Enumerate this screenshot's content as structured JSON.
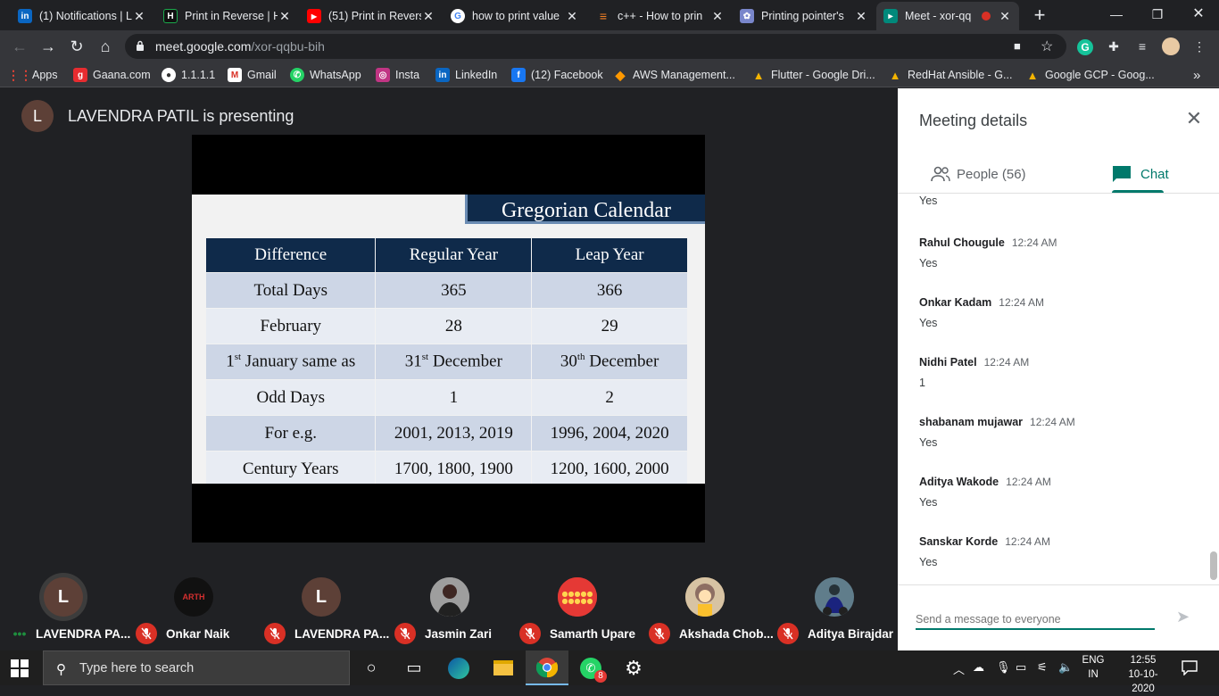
{
  "browser": {
    "tabs": [
      {
        "title": "(1) Notifications | L",
        "icon": "linkedin-icon",
        "color": "#0a66c2",
        "glyph": "in"
      },
      {
        "title": "Print in Reverse | H",
        "icon": "hackerrank-icon",
        "color": "#1ba94c",
        "glyph": "H"
      },
      {
        "title": "(51) Print in Revers",
        "icon": "youtube-icon",
        "color": "#ff0000",
        "glyph": "▶"
      },
      {
        "title": "how to print value",
        "icon": "google-icon",
        "color": "#ffffff",
        "glyph": "G"
      },
      {
        "title": "c++ - How to prin",
        "icon": "stackoverflow-icon",
        "color": "#f48024",
        "glyph": "≡"
      },
      {
        "title": "Printing pointer's",
        "icon": "site-icon",
        "color": "#7986cb",
        "glyph": "✿"
      },
      {
        "title": "Meet - xor-qq",
        "icon": "meet-icon",
        "color": "#00897b",
        "glyph": "▸"
      }
    ],
    "url_domain": "meet.google.com",
    "url_path": "/xor-qqbu-bih",
    "bookmarks": [
      {
        "label": "Apps",
        "icon": "apps-grid-icon",
        "color": "#ea4335",
        "glyph": "⋮"
      },
      {
        "label": "Gaana.com",
        "icon": "gaana-icon",
        "color": "#e72c30",
        "glyph": "g"
      },
      {
        "label": "1.1.1.1",
        "icon": "globe-icon",
        "color": "#555",
        "glyph": "●"
      },
      {
        "label": "Gmail",
        "icon": "gmail-icon",
        "color": "#d93025",
        "glyph": "M"
      },
      {
        "label": "WhatsApp",
        "icon": "whatsapp-icon",
        "color": "#25d366",
        "glyph": "✆"
      },
      {
        "label": "Insta",
        "icon": "instagram-icon",
        "color": "#c13584",
        "glyph": "◎"
      },
      {
        "label": "LinkedIn",
        "icon": "linkedin-icon",
        "color": "#0a66c2",
        "glyph": "in"
      },
      {
        "label": "(12) Facebook",
        "icon": "facebook-icon",
        "color": "#1877f2",
        "glyph": "f"
      },
      {
        "label": "AWS Management...",
        "icon": "aws-icon",
        "color": "#ff9900",
        "glyph": "◆"
      },
      {
        "label": "Flutter - Google Dri...",
        "icon": "drive-icon",
        "color": "#f4b400",
        "glyph": "▲"
      },
      {
        "label": "RedHat Ansible - G...",
        "icon": "drive-icon",
        "color": "#f4b400",
        "glyph": "▲"
      },
      {
        "label": "Google GCP - Goog...",
        "icon": "drive-icon",
        "color": "#f4b400",
        "glyph": "▲"
      }
    ],
    "bookmarks_more": "»"
  },
  "meet": {
    "presenter_initial": "L",
    "presenter_text": "LAVENDRA PATIL is presenting",
    "slide": {
      "title": "Gregorian Calendar",
      "headers": [
        "Difference",
        "Regular Year",
        "Leap Year"
      ],
      "rows": [
        [
          "Total Days",
          "365",
          "366"
        ],
        [
          "February",
          "28",
          "29"
        ],
        [
          "1st January same as",
          "31st December",
          "30th December"
        ],
        [
          "Odd Days",
          "1",
          "2"
        ],
        [
          "For e.g.",
          "2001, 2013, 2019",
          "1996, 2004, 2020"
        ],
        [
          "Century Years",
          "1700, 1800, 1900",
          "1200, 1600, 2000"
        ]
      ]
    },
    "panel": {
      "title": "Meeting details",
      "tab_people": "People (56)",
      "tab_chat": "Chat",
      "messages": [
        {
          "sender": "",
          "time": "",
          "text": "Yes"
        },
        {
          "sender": "Rahul Chougule",
          "time": "12:24 AM",
          "text": "Yes"
        },
        {
          "sender": "Onkar Kadam",
          "time": "12:24 AM",
          "text": "Yes"
        },
        {
          "sender": "Nidhi Patel",
          "time": "12:24 AM",
          "text": "1"
        },
        {
          "sender": "shabanam mujawar",
          "time": "12:24 AM",
          "text": "Yes"
        },
        {
          "sender": "Aditya Wakode",
          "time": "12:24 AM",
          "text": "Yes"
        },
        {
          "sender": "Sanskar Korde",
          "time": "12:24 AM",
          "text": "Yes"
        }
      ],
      "input_placeholder": "Send a message to everyone"
    },
    "participants": [
      {
        "name": "LAVENDRA PA...",
        "initial": "L",
        "color": "#5d4037",
        "muted": false
      },
      {
        "name": "Onkar Naik",
        "initial": "ARTH",
        "color": "#111111",
        "muted": true
      },
      {
        "name": "LAVENDRA PA...",
        "initial": "L",
        "color": "#5d4037",
        "muted": true
      },
      {
        "name": "Jasmin Zari",
        "initial": "",
        "color": "#8d8d8d",
        "muted": true
      },
      {
        "name": "Samarth Upare",
        "initial": "",
        "color": "#e53935",
        "muted": true
      },
      {
        "name": "Akshada Chob...",
        "initial": "",
        "color": "#c9a36b",
        "muted": true
      },
      {
        "name": "Aditya Birajdar",
        "initial": "",
        "color": "#37474f",
        "muted": true
      }
    ]
  },
  "taskbar": {
    "search_placeholder": "Type here to search",
    "lang_top": "ENG",
    "lang_bottom": "IN",
    "time": "12:55",
    "date": "10-10-2020",
    "whatsapp_badge": "8"
  }
}
